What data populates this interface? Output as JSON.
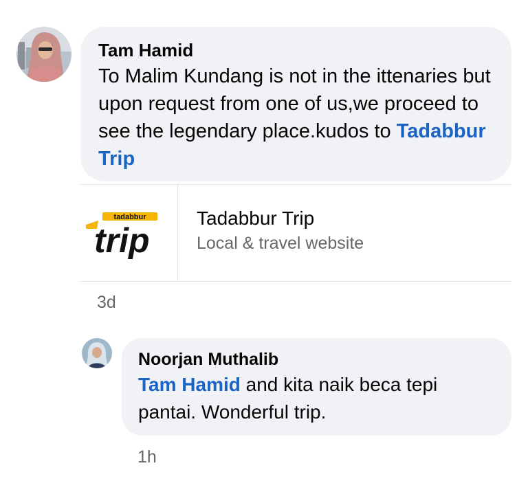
{
  "comment1": {
    "author": "Tam Hamid",
    "text": "To Malim Kundang is not in the ittenaries but upon request from one of us,we proceed to see the legendary place.kudos to ",
    "mention": "Tadabbur Trip",
    "timestamp": "3d"
  },
  "link_preview": {
    "logo_small_text": "tadabbur",
    "logo_big_text": "trip",
    "title": "Tadabbur Trip",
    "subtitle": "Local & travel website",
    "logo_colors": {
      "accent": "#f4b400",
      "main": "#111111"
    }
  },
  "comment2": {
    "author": "Noorjan Muthalib",
    "mention": "Tam Hamid",
    "text": " and kita naik beca tepi pantai. Wonderful trip.",
    "timestamp": "1h"
  },
  "colors": {
    "bubble": "#f0f2f5",
    "mention": "#1a64c6",
    "secondary_text": "#65676b"
  }
}
